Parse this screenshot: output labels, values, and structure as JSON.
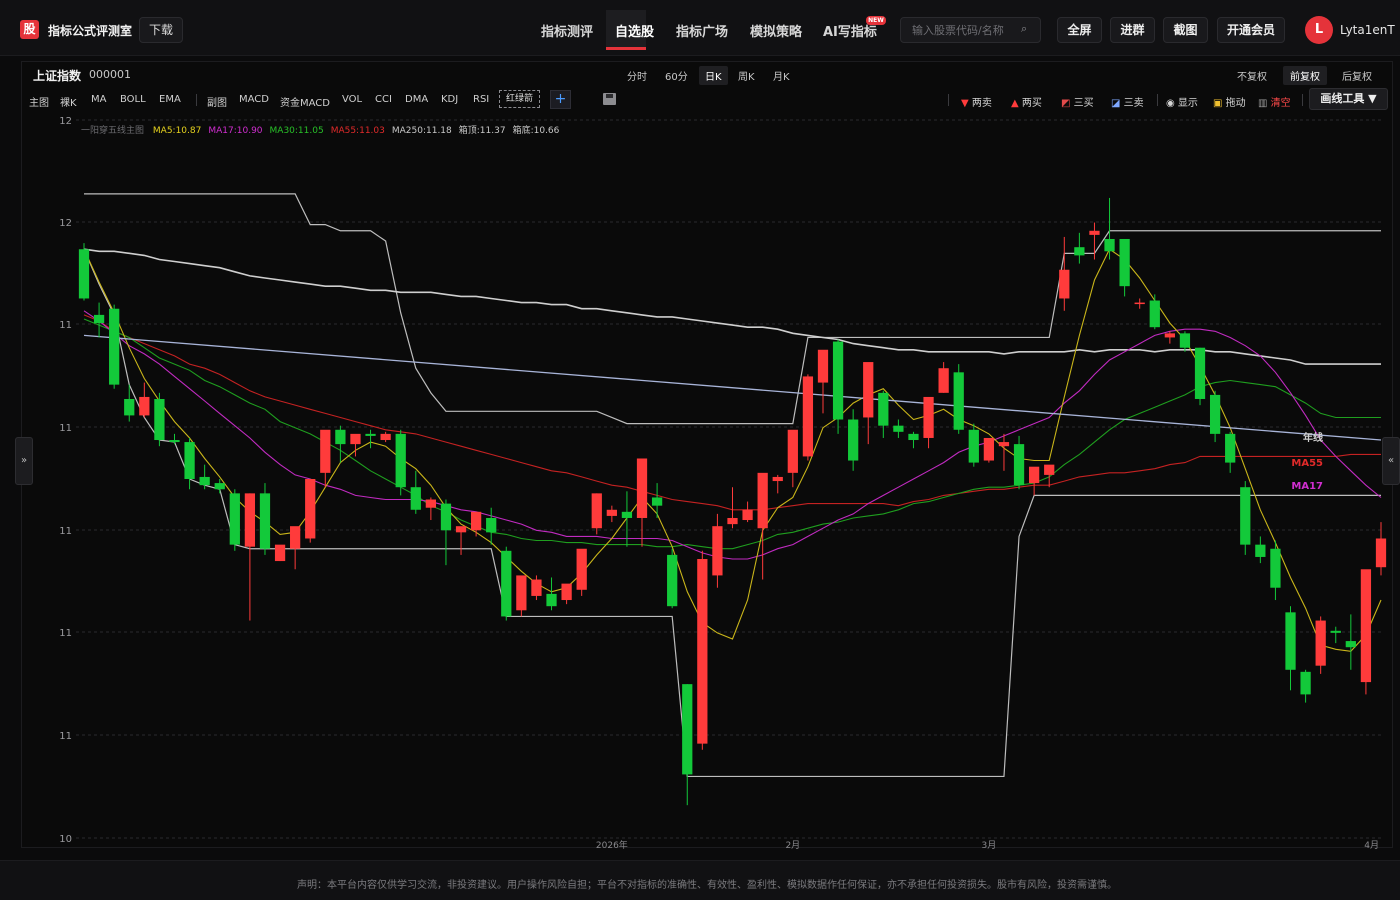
{
  "app": {
    "logo_char": "股",
    "brand": "指标公式评测室",
    "download_label": "下载",
    "nav": [
      "指标测评",
      "自选股",
      "指标广场",
      "模拟策略",
      "AI写指标"
    ],
    "new_badge": "NEW",
    "search_placeholder": "输入股票代码/名称",
    "buttons": [
      "全屏",
      "进群",
      "截图",
      "开通会员"
    ],
    "avatar": "L",
    "username": "Lyta1enT"
  },
  "stock": {
    "name": "上证指数",
    "code": "000001"
  },
  "periods": [
    "分时",
    "60分",
    "日K",
    "周K",
    "月K"
  ],
  "active_period": "日K",
  "adjust": [
    "不复权",
    "前复权",
    "后复权"
  ],
  "active_adjust": "前复权",
  "indicators": [
    "主图",
    "裸K",
    "MA",
    "BOLL",
    "EMA",
    "副图",
    "MACD",
    "资金MACD",
    "VOL",
    "CCI",
    "DMA",
    "KDJ",
    "RSI"
  ],
  "red_green_arrow": "红绿箭",
  "tools": [
    "两卖",
    "两买",
    "三买",
    "三卖",
    "显示",
    "拖动",
    "清空"
  ],
  "draw_tools": "画线工具 ▼",
  "legend": {
    "title": "一阳穿五线主图",
    "items": [
      "MA5:10.87",
      "MA17:10.90",
      "MA30:11.05",
      "MA55:11.03",
      "MA250:11.18",
      "箱顶:11.37",
      "箱底:10.66"
    ],
    "colors": [
      "#e6d21e",
      "#d02ed0",
      "#28c028",
      "#e02a2a",
      "#c8c8c8",
      "#c8c8c8",
      "#c8c8c8"
    ]
  },
  "line_labels": [
    "年线",
    "MA55",
    "MA17"
  ],
  "line_label_colors": [
    "#d0d0d0",
    "#e02a2a",
    "#d02ed0"
  ],
  "side_tab_left": "»",
  "side_tab_right": "«",
  "chart_data": {
    "type": "candlestick",
    "y_ticks": [
      "12",
      "12",
      "11",
      "11",
      "11",
      "11",
      "11",
      "10"
    ],
    "x_ticks": [
      "2026年",
      "2月",
      "3月",
      "4月"
    ],
    "colors": {
      "up": "#ff3b3b",
      "down": "#13c93a"
    },
    "candles": [
      {
        "o": 11.87,
        "h": 11.9,
        "c": 11.63,
        "l": 11.62
      },
      {
        "o": 11.55,
        "h": 11.61,
        "c": 11.51,
        "l": 11.44
      },
      {
        "o": 11.58,
        "h": 11.6,
        "c": 11.21,
        "l": 11.19
      },
      {
        "o": 11.14,
        "h": 11.21,
        "c": 11.06,
        "l": 11.03
      },
      {
        "o": 11.06,
        "h": 11.22,
        "c": 11.15,
        "l": 11.05
      },
      {
        "o": 11.14,
        "h": 11.17,
        "c": 10.94,
        "l": 10.91
      },
      {
        "o": 10.94,
        "h": 10.97,
        "c": 10.93,
        "l": 10.92
      },
      {
        "o": 10.93,
        "h": 10.95,
        "c": 10.75,
        "l": 10.7
      },
      {
        "o": 10.76,
        "h": 10.82,
        "c": 10.72,
        "l": 10.7
      },
      {
        "o": 10.73,
        "h": 10.75,
        "c": 10.7,
        "l": 10.68
      },
      {
        "o": 10.68,
        "h": 10.7,
        "c": 10.43,
        "l": 10.4
      },
      {
        "o": 10.42,
        "h": 10.68,
        "c": 10.68,
        "l": 10.06
      },
      {
        "o": 10.68,
        "h": 10.73,
        "c": 10.41,
        "l": 10.38
      },
      {
        "o": 10.35,
        "h": 10.42,
        "c": 10.43,
        "l": 10.35
      },
      {
        "o": 10.41,
        "h": 10.47,
        "c": 10.52,
        "l": 10.31
      },
      {
        "o": 10.46,
        "h": 10.62,
        "c": 10.75,
        "l": 10.44
      },
      {
        "o": 10.78,
        "h": 10.94,
        "c": 10.99,
        "l": 10.71
      },
      {
        "o": 10.99,
        "h": 11.01,
        "c": 10.92,
        "l": 10.83
      },
      {
        "o": 10.92,
        "h": 10.96,
        "c": 10.97,
        "l": 10.86
      },
      {
        "o": 10.97,
        "h": 10.99,
        "c": 10.96,
        "l": 10.9
      },
      {
        "o": 10.94,
        "h": 10.98,
        "c": 10.97,
        "l": 10.93
      },
      {
        "o": 10.97,
        "h": 10.99,
        "c": 10.71,
        "l": 10.67
      },
      {
        "o": 10.71,
        "h": 10.79,
        "c": 10.6,
        "l": 10.58
      },
      {
        "o": 10.61,
        "h": 10.66,
        "c": 10.65,
        "l": 10.55
      },
      {
        "o": 10.63,
        "h": 10.65,
        "c": 10.5,
        "l": 10.33
      },
      {
        "o": 10.49,
        "h": 10.5,
        "c": 10.52,
        "l": 10.38
      },
      {
        "o": 10.5,
        "h": 10.59,
        "c": 10.59,
        "l": 10.47
      },
      {
        "o": 10.56,
        "h": 10.61,
        "c": 10.49,
        "l": 10.43
      },
      {
        "o": 10.4,
        "h": 10.42,
        "c": 10.08,
        "l": 10.06
      },
      {
        "o": 10.11,
        "h": 10.26,
        "c": 10.28,
        "l": 10.08
      },
      {
        "o": 10.18,
        "h": 10.28,
        "c": 10.26,
        "l": 10.16
      },
      {
        "o": 10.19,
        "h": 10.27,
        "c": 10.13,
        "l": 10.11
      },
      {
        "o": 10.16,
        "h": 10.21,
        "c": 10.24,
        "l": 10.14
      },
      {
        "o": 10.21,
        "h": 10.39,
        "c": 10.41,
        "l": 10.18
      },
      {
        "o": 10.51,
        "h": 10.68,
        "c": 10.68,
        "l": 10.48
      },
      {
        "o": 10.57,
        "h": 10.62,
        "c": 10.6,
        "l": 10.54
      },
      {
        "o": 10.59,
        "h": 10.69,
        "c": 10.56,
        "l": 10.42
      },
      {
        "o": 10.56,
        "h": 10.85,
        "c": 10.85,
        "l": 10.42
      },
      {
        "o": 10.66,
        "h": 10.73,
        "c": 10.62,
        "l": 10.56
      },
      {
        "o": 10.38,
        "h": 10.41,
        "c": 10.13,
        "l": 10.12
      },
      {
        "o": 9.75,
        "h": 9.75,
        "c": 9.31,
        "l": 9.16
      },
      {
        "o": 9.46,
        "h": 10.4,
        "c": 10.36,
        "l": 9.43
      },
      {
        "o": 10.28,
        "h": 10.58,
        "c": 10.52,
        "l": 10.22
      },
      {
        "o": 10.53,
        "h": 10.71,
        "c": 10.56,
        "l": 10.51
      },
      {
        "o": 10.55,
        "h": 10.64,
        "c": 10.6,
        "l": 10.54
      },
      {
        "o": 10.51,
        "h": 10.67,
        "c": 10.78,
        "l": 10.26
      },
      {
        "o": 10.74,
        "h": 10.77,
        "c": 10.76,
        "l": 10.68
      },
      {
        "o": 10.78,
        "h": 10.98,
        "c": 10.99,
        "l": 10.71
      },
      {
        "o": 10.86,
        "h": 11.26,
        "c": 11.25,
        "l": 10.84
      },
      {
        "o": 11.22,
        "h": 11.33,
        "c": 11.38,
        "l": 11.07
      },
      {
        "o": 11.42,
        "h": 11.43,
        "c": 11.04,
        "l": 10.97
      },
      {
        "o": 11.04,
        "h": 11.09,
        "c": 10.84,
        "l": 10.79
      },
      {
        "o": 11.05,
        "h": 11.09,
        "c": 11.32,
        "l": 10.92
      },
      {
        "o": 11.17,
        "h": 11.18,
        "c": 11.01,
        "l": 10.95
      },
      {
        "o": 11.01,
        "h": 11.04,
        "c": 10.98,
        "l": 10.95
      },
      {
        "o": 10.97,
        "h": 10.98,
        "c": 10.94,
        "l": 10.9
      },
      {
        "o": 10.95,
        "h": 11.12,
        "c": 11.15,
        "l": 10.9
      },
      {
        "o": 11.17,
        "h": 11.32,
        "c": 11.29,
        "l": 11.17
      },
      {
        "o": 11.27,
        "h": 11.31,
        "c": 10.99,
        "l": 10.97
      },
      {
        "o": 10.99,
        "h": 11.02,
        "c": 10.83,
        "l": 10.81
      },
      {
        "o": 10.84,
        "h": 10.94,
        "c": 10.95,
        "l": 10.83
      },
      {
        "o": 10.91,
        "h": 10.97,
        "c": 10.93,
        "l": 10.79
      },
      {
        "o": 10.92,
        "h": 10.96,
        "c": 10.72,
        "l": 10.7
      },
      {
        "o": 10.73,
        "h": 10.76,
        "c": 10.81,
        "l": 10.67
      },
      {
        "o": 10.77,
        "h": 10.8,
        "c": 10.82,
        "l": 10.71
      },
      {
        "o": 11.63,
        "h": 11.93,
        "c": 11.77,
        "l": 11.57
      },
      {
        "o": 11.88,
        "h": 11.95,
        "c": 11.84,
        "l": 11.8
      },
      {
        "o": 11.94,
        "h": 12.0,
        "c": 11.96,
        "l": 11.82
      },
      {
        "o": 11.92,
        "h": 12.12,
        "c": 11.86,
        "l": 11.82
      },
      {
        "o": 11.92,
        "h": 11.92,
        "c": 11.69,
        "l": 11.64
      },
      {
        "o": 11.61,
        "h": 11.63,
        "c": 11.61,
        "l": 11.58
      },
      {
        "o": 11.62,
        "h": 11.65,
        "c": 11.49,
        "l": 11.48
      },
      {
        "o": 11.44,
        "h": 11.47,
        "c": 11.46,
        "l": 11.41
      },
      {
        "o": 11.46,
        "h": 11.47,
        "c": 11.39,
        "l": 11.37
      },
      {
        "o": 11.39,
        "h": 11.39,
        "c": 11.14,
        "l": 11.11
      },
      {
        "o": 11.16,
        "h": 11.18,
        "c": 10.97,
        "l": 10.93
      },
      {
        "o": 10.97,
        "h": 10.98,
        "c": 10.83,
        "l": 10.78
      },
      {
        "o": 10.71,
        "h": 10.74,
        "c": 10.43,
        "l": 10.38
      },
      {
        "o": 10.43,
        "h": 10.47,
        "c": 10.37,
        "l": 10.34
      },
      {
        "o": 10.41,
        "h": 10.45,
        "c": 10.22,
        "l": 10.16
      },
      {
        "o": 10.1,
        "h": 10.13,
        "c": 9.82,
        "l": 9.72
      },
      {
        "o": 9.81,
        "h": 9.82,
        "c": 9.7,
        "l": 9.66
      },
      {
        "o": 9.84,
        "h": 10.08,
        "c": 10.06,
        "l": 9.8
      },
      {
        "o": 10.01,
        "h": 10.03,
        "c": 10.0,
        "l": 9.95
      },
      {
        "o": 9.96,
        "h": 10.09,
        "c": 9.93,
        "l": 9.82
      },
      {
        "o": 9.76,
        "h": 10.12,
        "c": 10.31,
        "l": 9.7
      },
      {
        "o": 10.32,
        "h": 10.54,
        "c": 10.46,
        "l": 10.28
      }
    ],
    "ma5": [
      11.87,
      11.71,
      11.56,
      11.39,
      11.24,
      11.13,
      11.03,
      10.95,
      10.85,
      10.76,
      10.66,
      10.59,
      10.54,
      10.48,
      10.49,
      10.59,
      10.71,
      10.83,
      10.89,
      10.93,
      10.91,
      10.85,
      10.8,
      10.72,
      10.61,
      10.53,
      10.49,
      10.44,
      10.37,
      10.3,
      10.24,
      10.2,
      10.22,
      10.29,
      10.38,
      10.46,
      10.56,
      10.66,
      10.58,
      10.42,
      10.2,
      10.05,
      10.0,
      9.97,
      10.16,
      10.5,
      10.61,
      10.66,
      10.81,
      11.0,
      11.05,
      11.12,
      11.16,
      11.19,
      11.11,
      11.04,
      11.06,
      11.09,
      11.04,
      11.01,
      10.97,
      10.9,
      10.85,
      10.84,
      10.84,
      11.15,
      11.45,
      11.72,
      11.87,
      11.82,
      11.73,
      11.62,
      11.51,
      11.43,
      11.3,
      11.16,
      11.0,
      10.8,
      10.6,
      10.44,
      10.27,
      10.12,
      9.94,
      9.92,
      9.91,
      9.99,
      10.16
    ],
    "ma17": [
      11.57,
      11.52,
      11.46,
      11.4,
      11.36,
      11.31,
      11.25,
      11.19,
      11.13,
      11.07,
      11.01,
      10.95,
      10.88,
      10.82,
      10.77,
      10.75,
      10.72,
      10.7,
      10.67,
      10.66,
      10.65,
      10.65,
      10.65,
      10.64,
      10.62,
      10.6,
      10.59,
      10.57,
      10.55,
      10.53,
      10.5,
      10.49,
      10.47,
      10.47,
      10.47,
      10.46,
      10.46,
      10.46,
      10.46,
      10.45,
      10.42,
      10.39,
      10.37,
      10.36,
      10.36,
      10.38,
      10.41,
      10.43,
      10.47,
      10.51,
      10.55,
      10.58,
      10.63,
      10.67,
      10.71,
      10.75,
      10.79,
      10.83,
      10.88,
      10.91,
      10.93,
      10.96,
      10.99,
      11.02,
      11.05,
      11.12,
      11.18,
      11.26,
      11.33,
      11.37,
      11.41,
      11.45,
      11.47,
      11.48,
      11.48,
      11.47,
      11.44,
      11.4,
      11.35,
      11.27,
      11.17,
      11.06,
      10.94,
      10.86,
      10.79,
      10.72,
      10.66
    ],
    "ma30": [
      11.53,
      11.5,
      11.47,
      11.44,
      11.39,
      11.34,
      11.31,
      11.28,
      11.23,
      11.2,
      11.16,
      11.12,
      11.09,
      11.03,
      11.0,
      10.97,
      10.93,
      10.89,
      10.84,
      10.79,
      10.75,
      10.71,
      10.67,
      10.62,
      10.59,
      10.55,
      10.52,
      10.49,
      10.48,
      10.46,
      10.45,
      10.45,
      10.44,
      10.44,
      10.43,
      10.43,
      10.43,
      10.43,
      10.42,
      10.42,
      10.43,
      10.42,
      10.41,
      10.41,
      10.43,
      10.45,
      10.48,
      10.49,
      10.51,
      10.53,
      10.54,
      10.56,
      10.57,
      10.58,
      10.6,
      10.63,
      10.64,
      10.66,
      10.68,
      10.7,
      10.71,
      10.71,
      10.72,
      10.73,
      10.76,
      10.82,
      10.87,
      10.93,
      10.99,
      11.04,
      11.07,
      11.1,
      11.13,
      11.16,
      11.2,
      11.22,
      11.23,
      11.22,
      11.21,
      11.2,
      11.16,
      11.12,
      11.07,
      11.05,
      11.05,
      11.05,
      11.05
    ],
    "ma55": [
      11.55,
      11.52,
      11.47,
      11.44,
      11.41,
      11.38,
      11.35,
      11.31,
      11.29,
      11.26,
      11.22,
      11.18,
      11.15,
      11.13,
      11.11,
      11.09,
      11.07,
      11.05,
      11.03,
      11.01,
      10.99,
      10.98,
      10.97,
      10.95,
      10.93,
      10.91,
      10.89,
      10.87,
      10.85,
      10.83,
      10.81,
      10.79,
      10.78,
      10.76,
      10.74,
      10.72,
      10.71,
      10.69,
      10.67,
      10.65,
      10.64,
      10.63,
      10.62,
      10.6,
      10.6,
      10.6,
      10.61,
      10.62,
      10.63,
      10.63,
      10.63,
      10.63,
      10.63,
      10.63,
      10.62,
      10.64,
      10.65,
      10.67,
      10.68,
      10.69,
      10.7,
      10.7,
      10.71,
      10.72,
      10.72,
      10.74,
      10.76,
      10.77,
      10.78,
      10.78,
      10.79,
      10.8,
      10.82,
      10.83,
      10.86,
      10.86,
      10.86,
      10.86,
      10.86,
      10.86,
      10.86,
      10.86,
      10.86,
      10.86,
      10.87,
      10.87,
      10.87
    ],
    "ma250": [
      11.87,
      11.86,
      11.86,
      11.85,
      11.84,
      11.82,
      11.81,
      11.8,
      11.79,
      11.78,
      11.76,
      11.74,
      11.73,
      11.72,
      11.71,
      11.7,
      11.69,
      11.69,
      11.68,
      11.67,
      11.67,
      11.66,
      11.66,
      11.66,
      11.65,
      11.64,
      11.64,
      11.63,
      11.62,
      11.61,
      11.61,
      11.6,
      11.6,
      11.58,
      11.58,
      11.57,
      11.56,
      11.55,
      11.54,
      11.54,
      11.53,
      11.52,
      11.51,
      11.5,
      11.49,
      11.49,
      11.48,
      11.46,
      11.45,
      11.44,
      11.43,
      11.41,
      11.4,
      11.39,
      11.38,
      11.38,
      11.37,
      11.37,
      11.37,
      11.37,
      11.37,
      11.36,
      11.37,
      11.37,
      11.37,
      11.37,
      11.38,
      11.37,
      11.38,
      11.38,
      11.38,
      11.37,
      11.38,
      11.38,
      11.38,
      11.37,
      11.37,
      11.36,
      11.35,
      11.34,
      11.33,
      11.31,
      11.31,
      11.31,
      11.31,
      11.31,
      11.31
    ],
    "box_top": [
      12.14,
      12.14,
      12.14,
      12.14,
      12.14,
      12.14,
      12.14,
      12.14,
      12.14,
      12.14,
      12.14,
      12.14,
      12.14,
      12.14,
      12.14,
      11.99,
      11.99,
      11.96,
      11.96,
      11.96,
      11.91,
      11.56,
      11.29,
      11.17,
      11.08,
      11.08,
      11.08,
      11.08,
      11.08,
      11.08,
      11.08,
      11.08,
      11.08,
      11.08,
      11.08,
      11.05,
      11.02,
      11.02,
      11.02,
      11.02,
      11.02,
      11.02,
      11.02,
      11.02,
      11.02,
      11.02,
      11.02,
      11.02,
      11.44,
      11.44,
      11.44,
      11.44,
      11.44,
      11.44,
      11.44,
      11.44,
      11.44,
      11.44,
      11.44,
      11.44,
      11.44,
      11.44,
      11.44,
      11.44,
      11.44,
      11.85,
      11.85,
      11.85,
      11.96,
      11.96,
      11.96,
      11.96,
      11.96,
      11.96,
      11.96,
      11.96,
      11.96,
      11.96,
      11.96,
      11.96,
      11.96,
      11.96,
      11.96,
      11.96,
      11.96,
      11.96,
      11.96
    ],
    "box_bottom": [
      11.87,
      11.7,
      11.55,
      11.21,
      11.05,
      10.94,
      10.93,
      10.75,
      10.72,
      10.7,
      10.43,
      10.41,
      10.41,
      10.41,
      10.41,
      10.41,
      10.41,
      10.41,
      10.41,
      10.41,
      10.41,
      10.41,
      10.41,
      10.41,
      10.41,
      10.41,
      10.41,
      10.41,
      10.08,
      10.08,
      10.08,
      10.08,
      10.08,
      10.08,
      10.08,
      10.08,
      10.08,
      10.08,
      10.08,
      10.08,
      9.3,
      9.3,
      9.3,
      9.3,
      9.3,
      9.3,
      9.3,
      9.3,
      9.3,
      9.3,
      9.3,
      9.3,
      9.3,
      9.3,
      9.3,
      9.3,
      9.3,
      9.3,
      9.3,
      9.3,
      9.3,
      9.3,
      10.47,
      10.67,
      10.67,
      10.67,
      10.67,
      10.67,
      10.67,
      10.67,
      10.67,
      10.67,
      10.67,
      10.67,
      10.67,
      10.67,
      10.67,
      10.67,
      10.67,
      10.67,
      10.67,
      10.67,
      10.67,
      10.67,
      10.67,
      10.67,
      10.67
    ],
    "trend_line": {
      "start": 11.45,
      "end": 10.94
    }
  },
  "disclaimer": "声明：本平台内容仅供学习交流，非投资建议。用户操作风险自担；平台不对指标的准确性、有效性、盈利性、模拟数据作任何保证，亦不承担任何投资损失。股市有风险，投资需谨慎。"
}
